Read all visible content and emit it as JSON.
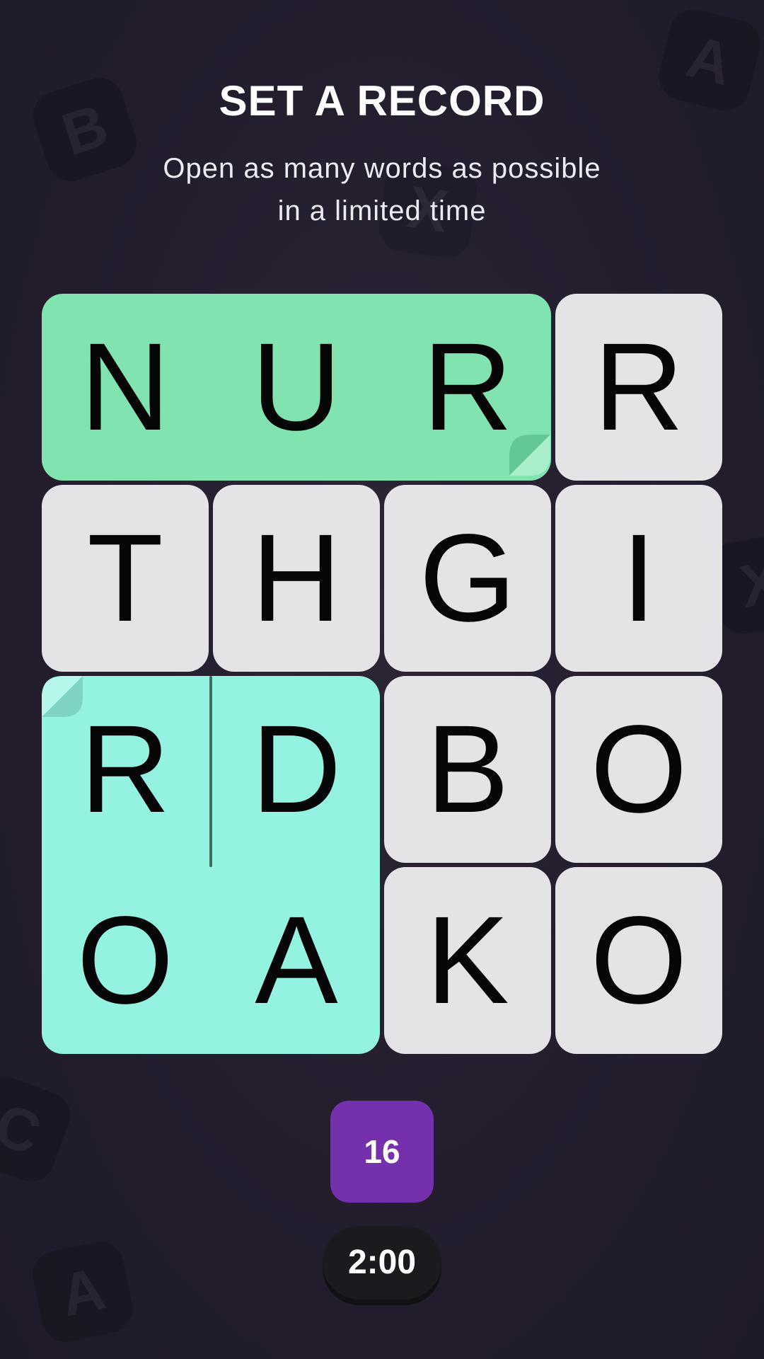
{
  "header": {
    "title": "SET A RECORD",
    "subtitle_line1": "Open as many words as possible",
    "subtitle_line2": "in a limited time"
  },
  "background_letters": [
    "B",
    "A",
    "X",
    "X",
    "C",
    "A"
  ],
  "grid": {
    "rows": [
      [
        "N",
        "U",
        "R",
        "R"
      ],
      [
        "T",
        "H",
        "G",
        "I"
      ],
      [
        "R",
        "D",
        "B",
        "O"
      ],
      [
        "O",
        "A",
        "K",
        "O"
      ]
    ],
    "opened_groups": [
      {
        "cells": [
          [
            0,
            0
          ],
          [
            0,
            1
          ],
          [
            0,
            2
          ]
        ],
        "color": "#81e3af"
      },
      {
        "cells": [
          [
            2,
            0
          ],
          [
            2,
            1
          ],
          [
            3,
            0
          ],
          [
            3,
            1
          ]
        ],
        "color": "#94f2e1"
      }
    ],
    "closed_tile_color": "#e4e4e6"
  },
  "status": {
    "words_count": "16",
    "timer": "2:00"
  },
  "colors": {
    "background": "#231d2e",
    "badge": "#7530ad",
    "timer_bg": "#1c1a1e"
  }
}
